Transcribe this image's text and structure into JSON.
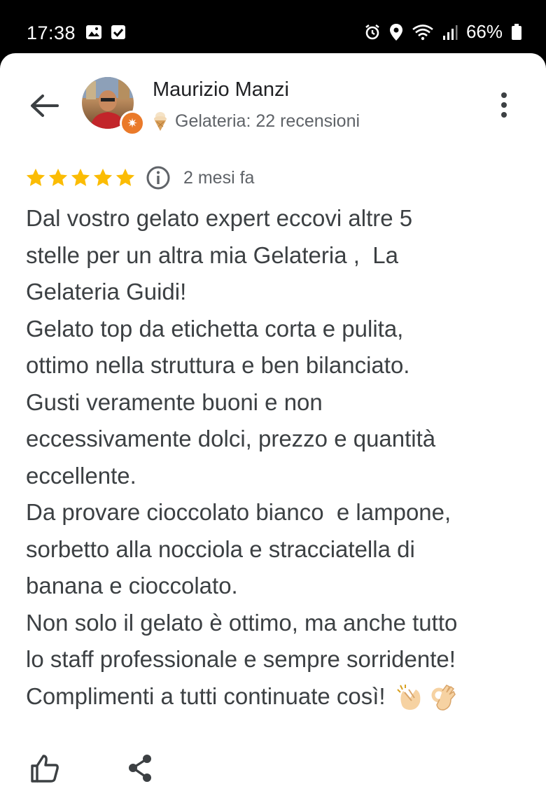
{
  "status_bar": {
    "time": "17:38",
    "battery": "66%",
    "icons": [
      "image-icon",
      "checkbox-icon",
      "alarm-icon",
      "location-icon",
      "wifi-icon",
      "signal-icon",
      "battery-icon"
    ]
  },
  "header": {
    "back_icon": "arrow-back-icon",
    "reviewer_name": "Maurizio Manzi",
    "reviewer_subtitle": "Gelateria: 22 recensioni",
    "subtitle_emoji": "ice-cream-icon",
    "badge_icon": "local-guide-star-icon",
    "more_icon": "more-vert-icon"
  },
  "review": {
    "rating": 5,
    "max_rating": 5,
    "star_color": "#fbbc04",
    "time_ago": "2 mesi fa",
    "text": "Dal vostro gelato expert eccovi altre 5\nstelle per un altra mia Gelateria ,  La\nGelateria Guidi!\nGelato top da etichetta corta e pulita,\nottimo nella struttura e ben bilanciato.\nGusti veramente buoni e non\neccessivamente dolci, prezzo e quantità\neccellente.\nDa provare cioccolato bianco  e lampone,\nsorbetto alla nocciola e stracciatella di\nbanana e cioccolato.\nNon solo il gelato è ottimo, ma anche tutto\nlo staff professionale e sempre sorridente!\nComplimenti a tutti continuate così! ",
    "trailing_emojis": [
      "clapping-hands-icon",
      "ok-hand-icon"
    ]
  },
  "actions": {
    "like_icon": "thumbs-up-icon",
    "share_icon": "share-icon"
  }
}
